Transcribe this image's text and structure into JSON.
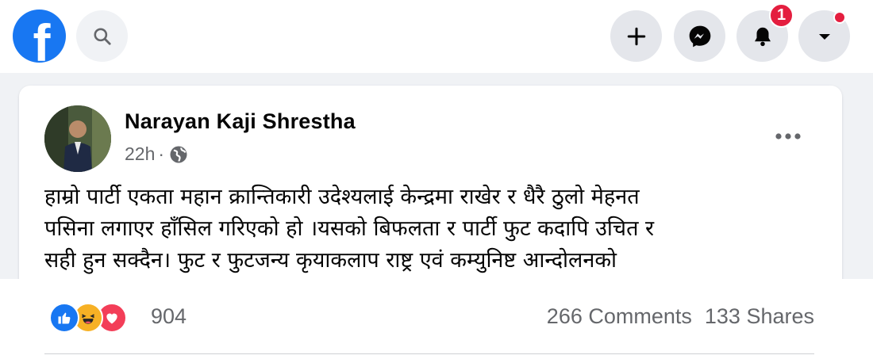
{
  "topbar": {
    "logo_glyph": "f",
    "logo_icon": "facebook-logo-icon",
    "search_icon": "search-icon",
    "create_icon": "plus-icon",
    "messenger_icon": "messenger-icon",
    "notifications_icon": "bell-icon",
    "notifications_badge": "1",
    "account_icon": "caret-down-icon"
  },
  "post": {
    "author": "Narayan Kaji Shrestha",
    "time": "22h",
    "separator": "·",
    "audience_icon": "globe-icon",
    "more_icon": "ellipsis-icon",
    "text_lines": [
      "हाम्रो पार्टी एकता महान क्रान्तिकारी उदेश्यलाई केन्द्रमा राखेर र धैरै ठुलो मेहनत",
      "पसिना लगाएर हाँसिल गरिएको हो ।यसको बिफलता र पार्टी फुट कदापि उचित र",
      "सही हुन सक्दैन। फुट र फुटजन्य कृयाकलाप राष्ट्र एवं कम्युनिष्ट आन्दोलनको"
    ]
  },
  "engagement": {
    "reaction_icons": [
      "like-icon",
      "haha-icon",
      "love-icon"
    ],
    "reaction_count": "904",
    "comments": "266 Comments",
    "shares": "133 Shares"
  },
  "colors": {
    "brand": "#1877f2",
    "badge": "#e41e3f",
    "love": "#f33e58",
    "haha": "#f7b125",
    "secondary_text": "#65676b"
  }
}
